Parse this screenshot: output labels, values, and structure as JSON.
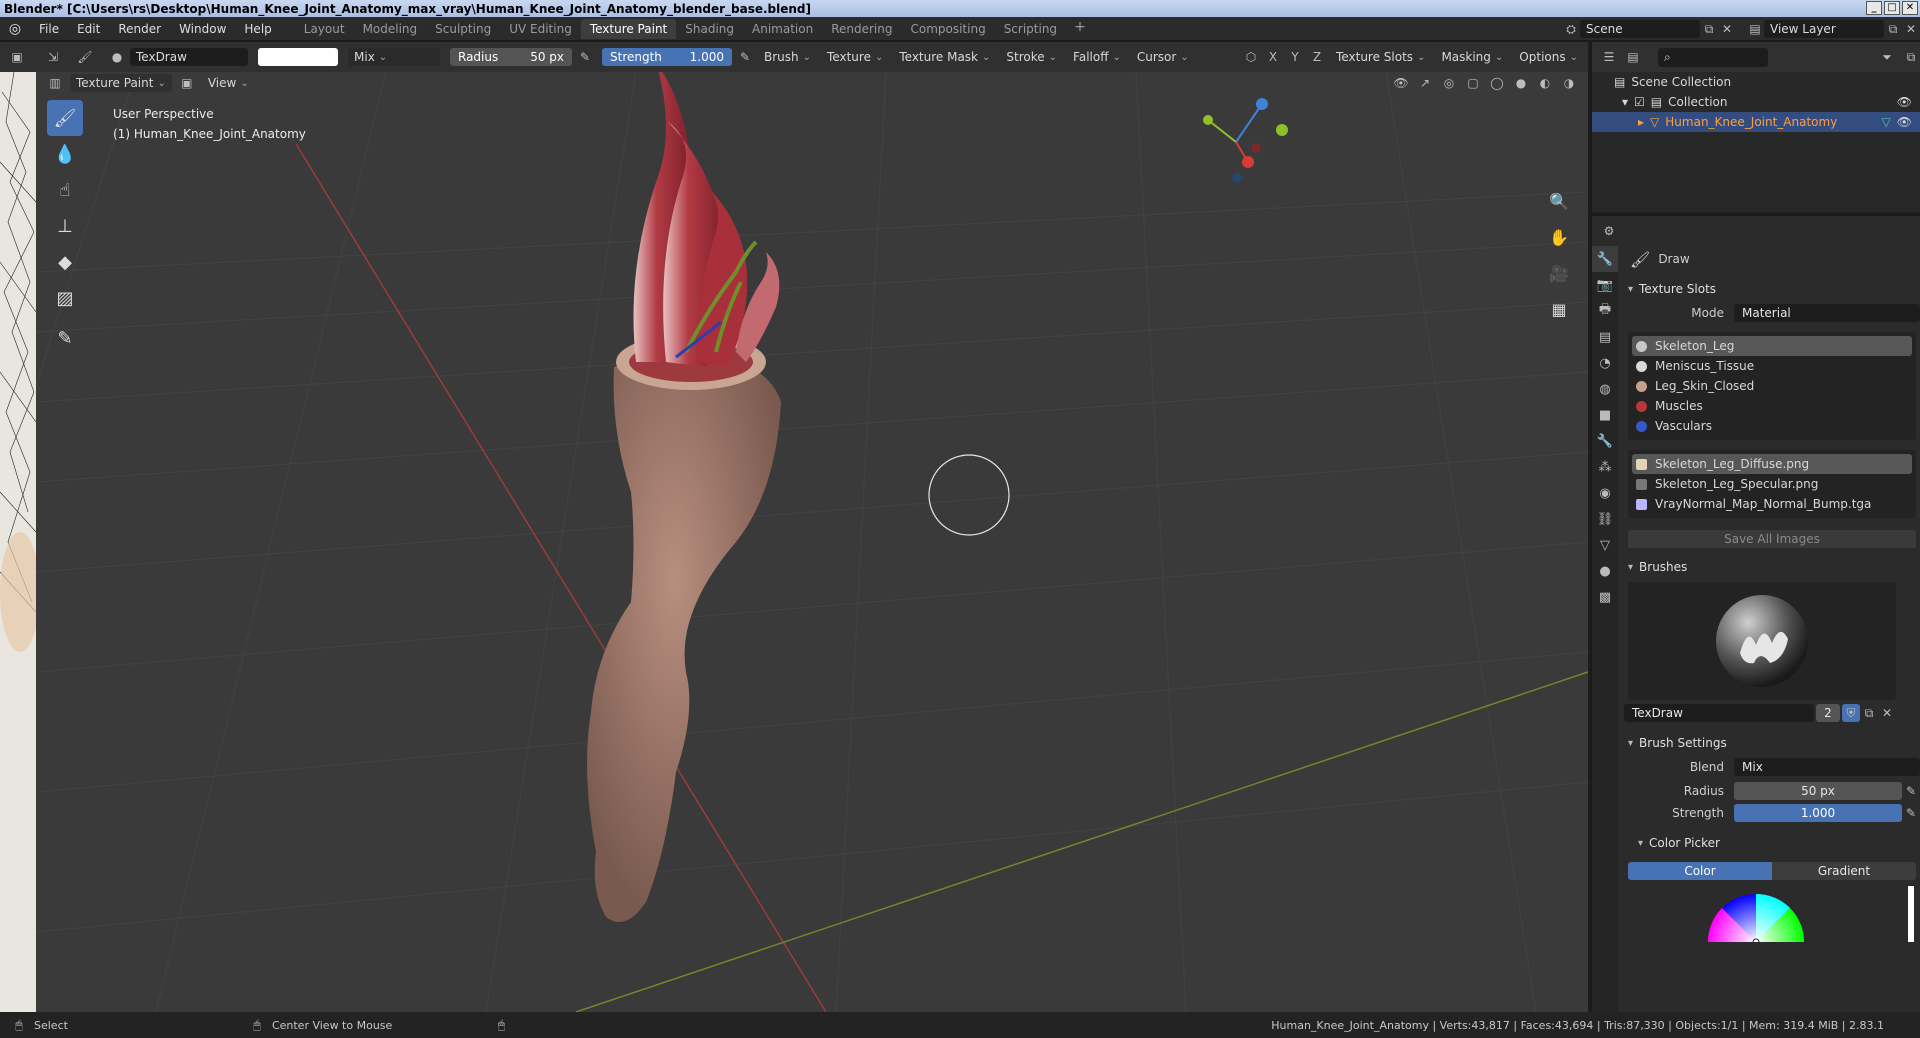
{
  "titlebar": {
    "text": "Blender* [C:\\Users\\rs\\Desktop\\Human_Knee_Joint_Anatomy_max_vray\\Human_Knee_Joint_Anatomy_blender_base.blend]"
  },
  "menu": {
    "items": [
      "File",
      "Edit",
      "Render",
      "Window",
      "Help"
    ],
    "workspaces": [
      "Layout",
      "Modeling",
      "Sculpting",
      "UV Editing",
      "Texture Paint",
      "Shading",
      "Animation",
      "Rendering",
      "Compositing",
      "Scripting"
    ],
    "active_workspace": "Texture Paint",
    "scene": "Scene",
    "view_layer": "View Layer"
  },
  "toolheader": {
    "brush_name": "TexDraw",
    "blend": "Mix",
    "radius_label": "Radius",
    "radius_value": "50 px",
    "strength_label": "Strength",
    "strength_value": "1.000",
    "menus": [
      "Brush",
      "Texture",
      "Texture Mask",
      "Stroke",
      "Falloff",
      "Cursor"
    ],
    "axes": [
      "X",
      "Y",
      "Z"
    ],
    "right_menus": [
      "Texture Slots",
      "Masking",
      "Options"
    ]
  },
  "vpheader": {
    "mode": "Texture Paint",
    "view": "View"
  },
  "viewport": {
    "perspective": "User Perspective",
    "object": "(1) Human_Knee_Joint_Anatomy"
  },
  "outliner": {
    "scene_collection": "Scene Collection",
    "collection": "Collection",
    "object": "Human_Knee_Joint_Anatomy"
  },
  "properties": {
    "tool_name": "Draw",
    "texture_slots_title": "Texture Slots",
    "mode_label": "Mode",
    "mode_value": "Material",
    "materials": [
      {
        "name": "Skeleton_Leg",
        "color": "#c8c8c8"
      },
      {
        "name": "Meniscus_Tissue",
        "color": "#d9d9d9"
      },
      {
        "name": "Leg_Skin_Closed",
        "color": "#c7a08c"
      },
      {
        "name": "Muscles",
        "color": "#b8393b"
      },
      {
        "name": "Vasculars",
        "color": "#3658c9"
      }
    ],
    "images": [
      {
        "name": "Skeleton_Leg_Diffuse.png",
        "color": "#e2d4b5"
      },
      {
        "name": "Skeleton_Leg_Specular.png",
        "color": "#777777"
      },
      {
        "name": "VrayNormal_Map_Normal_Bump.tga",
        "color": "#b9b6ff"
      }
    ],
    "save_all": "Save All Images",
    "brushes_title": "Brushes",
    "brush_name": "TexDraw",
    "brush_users": "2",
    "brush_settings_title": "Brush Settings",
    "blend_label": "Blend",
    "blend_value": "Mix",
    "radius_label": "Radius",
    "radius_value": "50 px",
    "strength_label": "Strength",
    "strength_value": "1.000",
    "color_picker_title": "Color Picker",
    "tab_color": "Color",
    "tab_gradient": "Gradient"
  },
  "statusbar": {
    "select": "Select",
    "center_view": "Center View to Mouse",
    "stats": "Human_Knee_Joint_Anatomy | Verts:43,817 | Faces:43,694 | Tris:87,330 | Objects:1/1 | Mem: 319.4 MiB | 2.83.1"
  }
}
